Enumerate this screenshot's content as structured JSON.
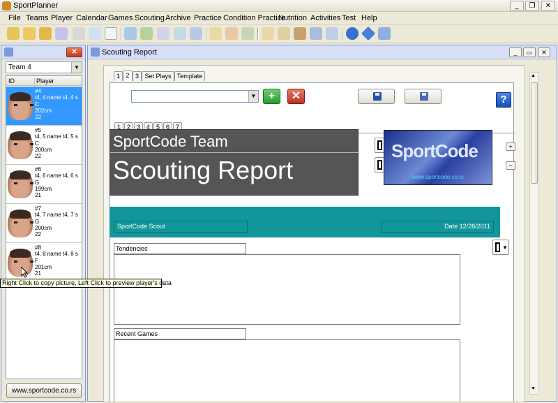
{
  "app": {
    "title": "SportPlanner"
  },
  "menu": [
    "File",
    "Teams",
    "Player",
    "Calendar",
    "Games",
    "Scouting",
    "Archive",
    "Practice",
    "Condition Practice",
    "Nutrition",
    "Activities",
    "Test",
    "Help"
  ],
  "toolbar_icons": [
    "open-folder-icon",
    "folder-icon",
    "folder-icon",
    "edit-icon",
    "print-icon",
    "preview-icon",
    "document-icon",
    "chart-icon",
    "table-icon",
    "calendar-icon",
    "diagram-icon",
    "grid-icon",
    "clipboard-icon",
    "clipboard-icon",
    "strategy-icon",
    "list-icon",
    "notes-icon",
    "field-icon",
    "filter-icon",
    "columns-icon",
    "help-icon",
    "info-icon",
    "tools-icon"
  ],
  "left_panel": {
    "team": "Team 4",
    "columns": [
      "ID",
      "Player"
    ],
    "players": [
      {
        "id": "#4",
        "name": "t4, 4 name t4, 4 s",
        "pos": "C",
        "height": "202cm",
        "age": "22",
        "selected": true
      },
      {
        "id": "#5",
        "name": "t4, 5 name t4, 5 s",
        "pos": "C",
        "height": "200cm",
        "age": "22",
        "selected": false
      },
      {
        "id": "#6",
        "name": "t4, 6 name t4, 6 s",
        "pos": "G",
        "height": "199cm",
        "age": "21",
        "selected": false
      },
      {
        "id": "#7",
        "name": "t4, 7 name t4, 7 s",
        "pos": "G",
        "height": "200cm",
        "age": "22",
        "selected": false
      },
      {
        "id": "#8",
        "name": "t4, 8 name t4, 8 s",
        "pos": "F",
        "height": "201cm",
        "age": "21",
        "selected": false
      }
    ],
    "site_button": "www.sportcode.co.rs",
    "tooltip": "Right Click to copy picture, Left Click to preview player's data"
  },
  "main": {
    "title": "Scouting Report",
    "tabs": [
      "1",
      "2",
      "3",
      "Set Plays",
      "Template"
    ],
    "active_tab": "2",
    "combo_value": "",
    "inner_tabs": [
      "1",
      "2",
      "3",
      "4",
      "5",
      "6",
      "7"
    ],
    "report": {
      "team": "SportCode Team",
      "heading": "Scouting Report",
      "logo_text": "SportCode",
      "logo_url": "www.sportcode.co.rs",
      "scout": "SportCode Scout",
      "date": "Date 12/28/2011",
      "sections": [
        "Tendencies",
        "Recent Games"
      ]
    }
  },
  "colors": {
    "teal": "#11969b",
    "selection": "#3399ff",
    "panel_header": "#d6dff7"
  }
}
